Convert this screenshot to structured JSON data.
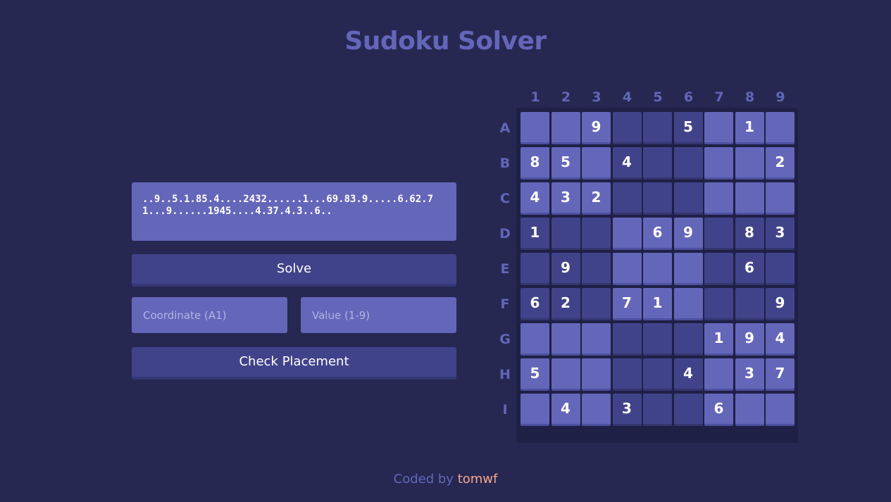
{
  "title": "Sudoku Solver",
  "puzzle_string": "..9..5.1.85.4....2432......1...69.83.9.....6.62.71...9......1945....4.37.4.3..6..",
  "buttons": {
    "solve": "Solve",
    "check": "Check Placement"
  },
  "inputs": {
    "coordinate_placeholder": "Coordinate (A1)",
    "value_placeholder": "Value (1-9)",
    "coordinate_value": "",
    "value_value": ""
  },
  "board": {
    "column_labels": [
      "1",
      "2",
      "3",
      "4",
      "5",
      "6",
      "7",
      "8",
      "9"
    ],
    "row_labels": [
      "A",
      "B",
      "C",
      "D",
      "E",
      "F",
      "G",
      "H",
      "I"
    ],
    "cells": [
      [
        "",
        "",
        "9",
        "",
        "",
        "5",
        "",
        "1",
        ""
      ],
      [
        "8",
        "5",
        "",
        "4",
        "",
        "",
        "",
        "",
        "2"
      ],
      [
        "4",
        "3",
        "2",
        "",
        "",
        "",
        "",
        "",
        ""
      ],
      [
        "1",
        "",
        "",
        "",
        "6",
        "9",
        "",
        "8",
        "3"
      ],
      [
        "",
        "9",
        "",
        "",
        "",
        "",
        "",
        "6",
        ""
      ],
      [
        "6",
        "2",
        "",
        "7",
        "1",
        "",
        "",
        "",
        "9"
      ],
      [
        "",
        "",
        "",
        "",
        "",
        "",
        "1",
        "9",
        "4"
      ],
      [
        "5",
        "",
        "",
        "",
        "",
        "4",
        "",
        "3",
        "7"
      ],
      [
        "",
        "4",
        "",
        "3",
        "",
        "",
        "6",
        "",
        ""
      ]
    ]
  },
  "colors": {
    "background": "#262852",
    "accent": "#6366b9",
    "cell_light": "#6466ba",
    "cell_dark": "#41438a",
    "author": "#f7a68a"
  },
  "footer": {
    "prefix": "Coded by",
    "author": "tomwf"
  }
}
